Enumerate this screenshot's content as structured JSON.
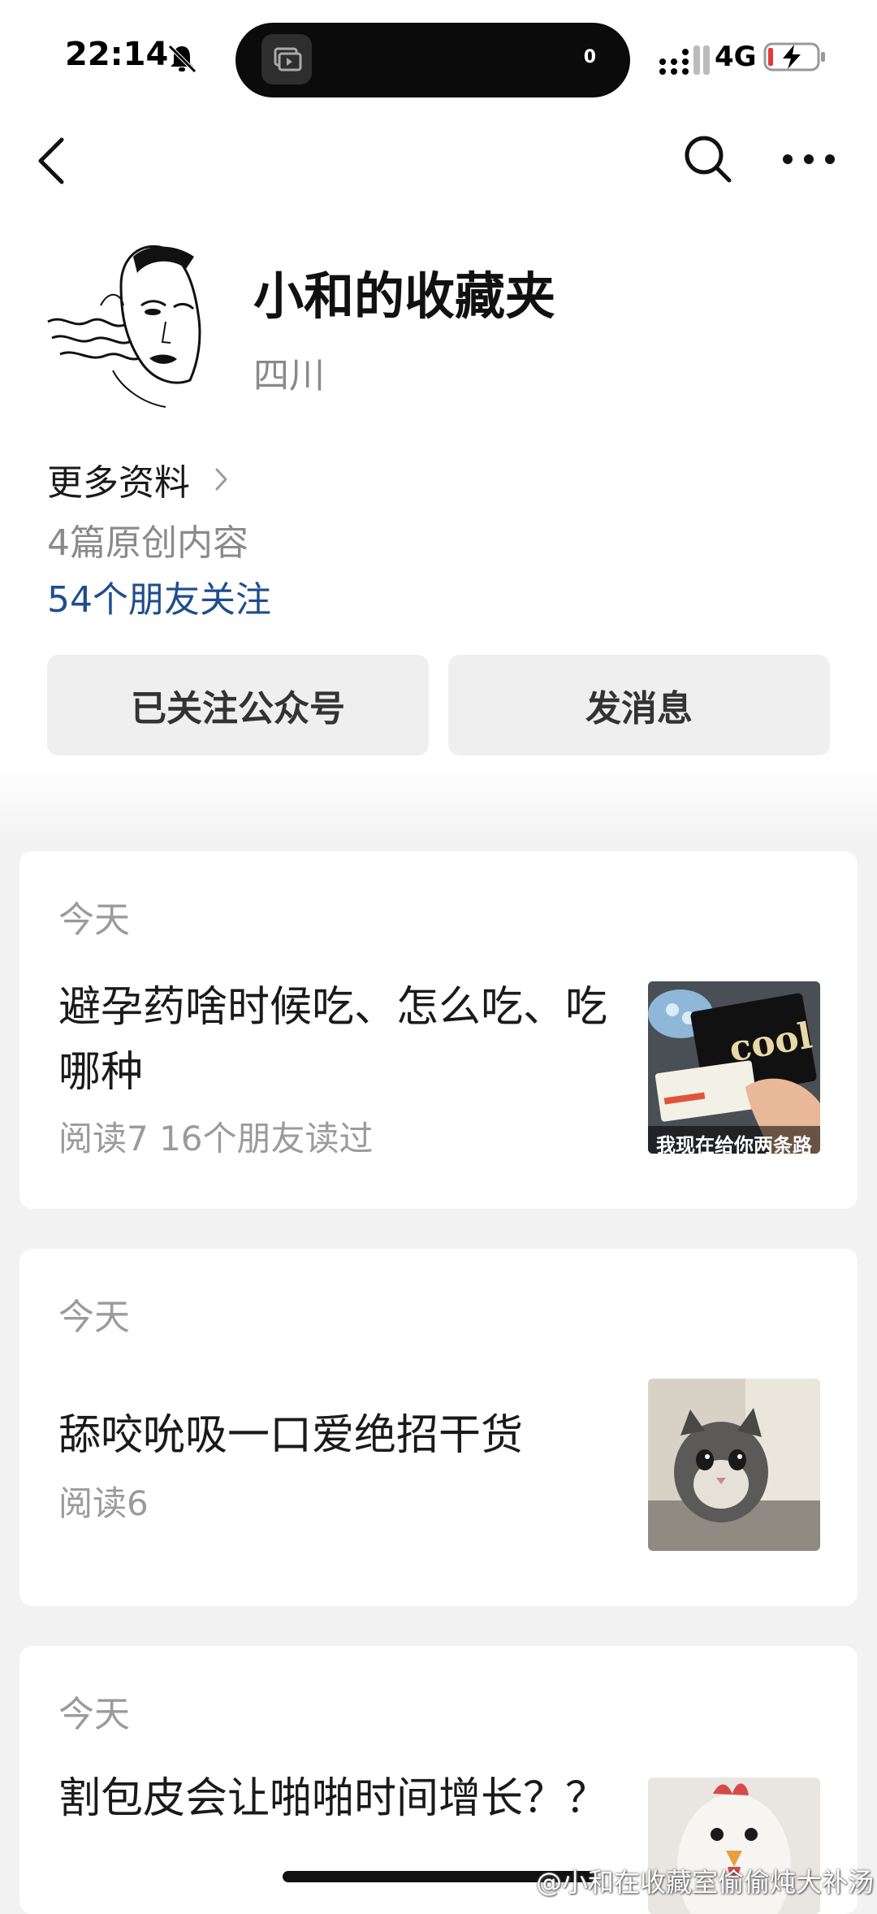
{
  "status_bar": {
    "time": "22:14",
    "island_count": "0",
    "network": "4G",
    "icons": [
      "bell-muted-icon",
      "signal-icon",
      "battery-charging-icon"
    ]
  },
  "nav": {
    "icons": [
      "back-chevron-icon",
      "search-icon",
      "more-dots-icon"
    ]
  },
  "profile": {
    "name": "小和的收藏夹",
    "region": "四川",
    "more_info": "更多资料",
    "original_count": "4篇原创内容",
    "friends_following": "54个朋友关注"
  },
  "actions": {
    "followed_label": "已关注公众号",
    "message_label": "发消息"
  },
  "articles": [
    {
      "date": "今天",
      "title": "避孕药啥时候吃、怎么吃、吃哪种",
      "meta": "阅读7  16个朋友读过",
      "thumb_caption": "我现在给你两条路",
      "thumb_text": "cool"
    },
    {
      "date": "今天",
      "title": "舔咬吮吸一口爱绝招干货",
      "meta": "阅读6"
    },
    {
      "date": "今天",
      "title": "割包皮会让啪啪时间增长？？"
    }
  ],
  "watermark": "@小和在收藏室偷偷炖大补汤",
  "colors": {
    "link_blue": "#1f4d8c",
    "muted_gray": "#9b9b9b",
    "button_bg": "#efefef",
    "page_bg": "#f2f2f2"
  }
}
